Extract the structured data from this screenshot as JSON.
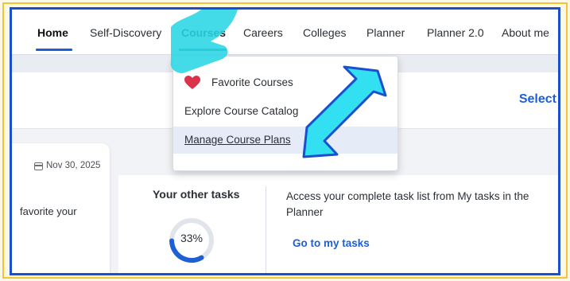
{
  "nav": {
    "items": [
      {
        "label": "Home"
      },
      {
        "label": "Self-Discovery"
      },
      {
        "label": "Courses"
      },
      {
        "label": "Careers"
      },
      {
        "label": "Colleges"
      },
      {
        "label": "Planner"
      },
      {
        "label": "Planner 2.0"
      },
      {
        "label": "About me"
      }
    ],
    "active": "Home",
    "open_menu": "Courses"
  },
  "header": {
    "select_link": "Select"
  },
  "courses_menu": {
    "items": [
      {
        "label": "Favorite Courses",
        "icon": "heart-icon"
      },
      {
        "label": "Explore Course Catalog"
      },
      {
        "label": "Manage Course Plans",
        "highlighted": true
      }
    ]
  },
  "left_card": {
    "date": "Nov 30, 2025",
    "text": "favorite your"
  },
  "tasks": {
    "title": "Your other tasks",
    "progress_text": "33%",
    "progress_value": 0.33,
    "description": "Access your complete task list from My tasks in the Planner",
    "link": "Go to my tasks"
  },
  "colors": {
    "accent_blue": "#1f5fd6",
    "courses_underline": "#1a8b78",
    "frame_blue": "#1b4fd0",
    "frame_gold": "#f1c43b",
    "heart_red": "#d8344a",
    "arrow_fill": "#33e0f2",
    "arrow_outline": "#1b4fd0",
    "highlight_teal": "#2ad6e6"
  }
}
